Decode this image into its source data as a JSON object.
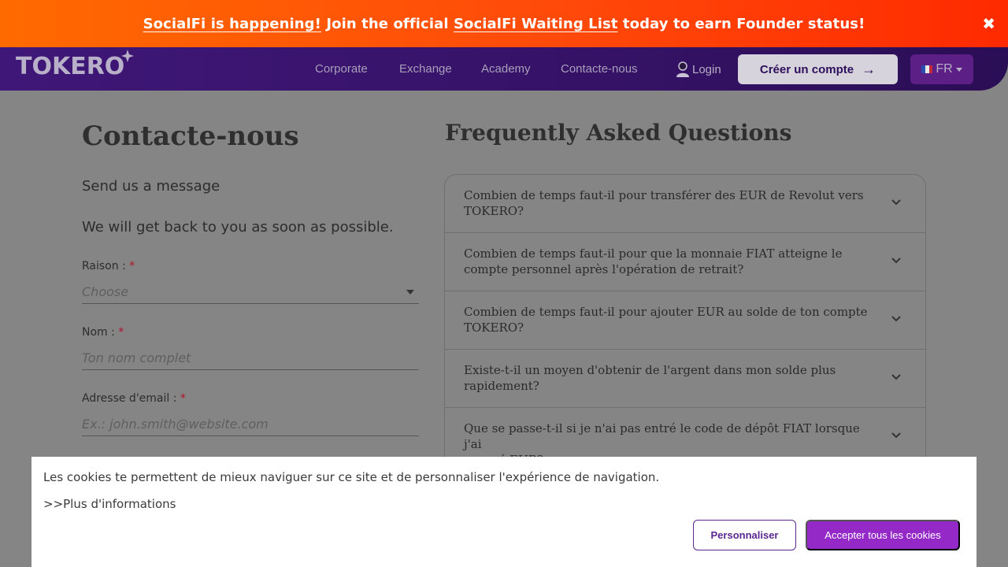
{
  "promo": {
    "bold_lead": "SocialFi is happening!",
    "text1": " Join the official ",
    "link": "SocialFi Waiting List",
    "text2": " today to earn Founder status!",
    "close_glyph": "✖"
  },
  "nav": {
    "logo": "TOKERO",
    "links": [
      "Corporate",
      "Exchange",
      "Academy",
      "Contacte-nous"
    ],
    "login": "Login",
    "signup": "Créer un compte",
    "signup_arrow": "→",
    "lang": "FR"
  },
  "contact": {
    "title": "Contacte-nous",
    "subtitle": "Send us a message",
    "description": "We will get back to you as soon as possible.",
    "required_mark": "*",
    "reason_label": "Raison :",
    "reason_placeholder": "Choose",
    "name_label": "Nom :",
    "name_placeholder": "Ton nom complet",
    "email_label": "Adresse d'email :",
    "email_placeholder": "Ex.: john.smith@website.com"
  },
  "faq": {
    "title": "Frequently Asked Questions",
    "items": [
      {
        "line1": "Combien de temps faut-il pour transférer des EUR de Revolut vers",
        "line2": "TOKERO?"
      },
      {
        "line1": "Combien de temps faut-il pour que la monnaie FIAT atteigne le",
        "line2": "compte personnel après l'opération de retrait?"
      },
      {
        "line1": "Combien de temps faut-il pour ajouter EUR au solde de ton compte",
        "line2": "TOKERO?"
      },
      {
        "line1": "Existe-t-il un moyen d'obtenir de l'argent dans mon solde plus",
        "line2": "rapidement?"
      },
      {
        "line1": "Que se passe-t-il si je n'ai pas entré le code de dépôt FIAT lorsque j'ai",
        "line2": "envoyé EUR?"
      }
    ]
  },
  "cookie": {
    "text": "Les cookies te permettent de mieux naviguer sur ce site et de personnaliser l'expérience de navigation.",
    "more": ">>Plus d'informations",
    "customize": "Personnaliser",
    "accept": "Accepter tous les cookies"
  },
  "colors": {
    "promo_start": "#ff6a00",
    "promo_end": "#ff2a00",
    "navbar": "#3a1470",
    "accent_purple": "#9429c7",
    "overlay_bg": "#858585"
  },
  "icons": {
    "close": "close-icon",
    "user": "user-icon",
    "arrow": "arrow-right-icon",
    "flag": "flag-fr-icon",
    "chevron": "chevron-down-icon",
    "caret": "caret-down-icon"
  }
}
